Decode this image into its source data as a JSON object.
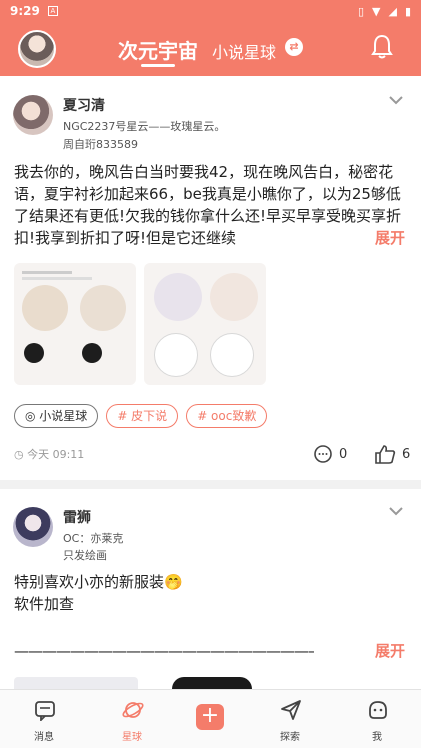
{
  "status_bar": {
    "time": "9:29",
    "notif_letter": "A"
  },
  "app_bar": {
    "active_tab": "次元宇宙",
    "second_tab": "小说星球",
    "accent": "#F47C6A"
  },
  "post1": {
    "author": "夏习清",
    "bio": "NGC2237号星云——玫瑰星云。",
    "class": "周自珩833589",
    "text": "我去你的，晚风告白当时要我42，现在晚风告白，秘密花语，夏宇衬衫加起来66，be我真是小瞧你了，以为25够低了结果还有更低!欠我的钱你拿什么还!早买早享受晚买享折扣!我享到折扣了呀!但是它还继续",
    "expand": "展开",
    "tags": [
      "小说星球",
      "# 皮下说",
      "# ooc致歉"
    ],
    "time": "今天 09:11",
    "comments": "0",
    "likes": "6"
  },
  "post2": {
    "author": "雷狮",
    "bio": "OC：亦莱克",
    "bio2": "只发绘画",
    "line1": "特别喜欢小亦的新服装🤭",
    "line2": "软件加查",
    "divider": "——————————————————————",
    "expand": "展开"
  },
  "bottom_nav": {
    "items": [
      "消息",
      "星球",
      "",
      "探索",
      "我"
    ],
    "active": "星球"
  }
}
